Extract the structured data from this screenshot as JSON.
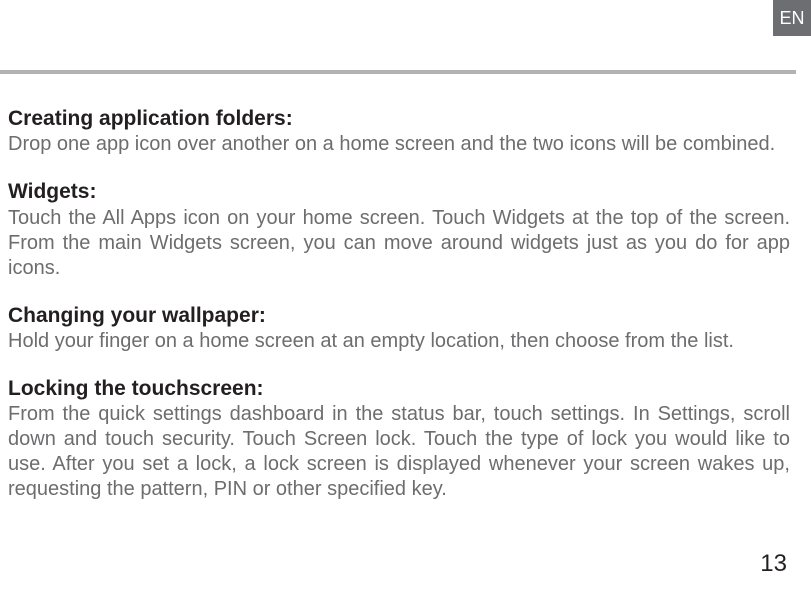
{
  "lang_label": "EN",
  "sections": [
    {
      "heading": "Creating application folders:",
      "body": "Drop one app icon over another on a home screen and the two icons will be combined."
    },
    {
      "heading": "Widgets:",
      "body": "Touch the All Apps icon on your home screen. Touch Widgets at the top of the screen. From the main Widgets screen, you can move around widgets just as you do for app icons."
    },
    {
      "heading": "Changing your wallpaper:",
      "body": "Hold your finger on a home screen at an empty location, then choose from the list."
    },
    {
      "heading": "Locking the touchscreen:",
      "body": "From the quick settings dashboard in the status bar, touch settings. In Settings, scroll down and touch security. Touch Screen lock. Touch the type of lock you would like to use. After you set a lock, a lock screen is displayed whenever your screen wakes up, requesting the pattern, PIN or other specified key."
    }
  ],
  "page_number": "13"
}
